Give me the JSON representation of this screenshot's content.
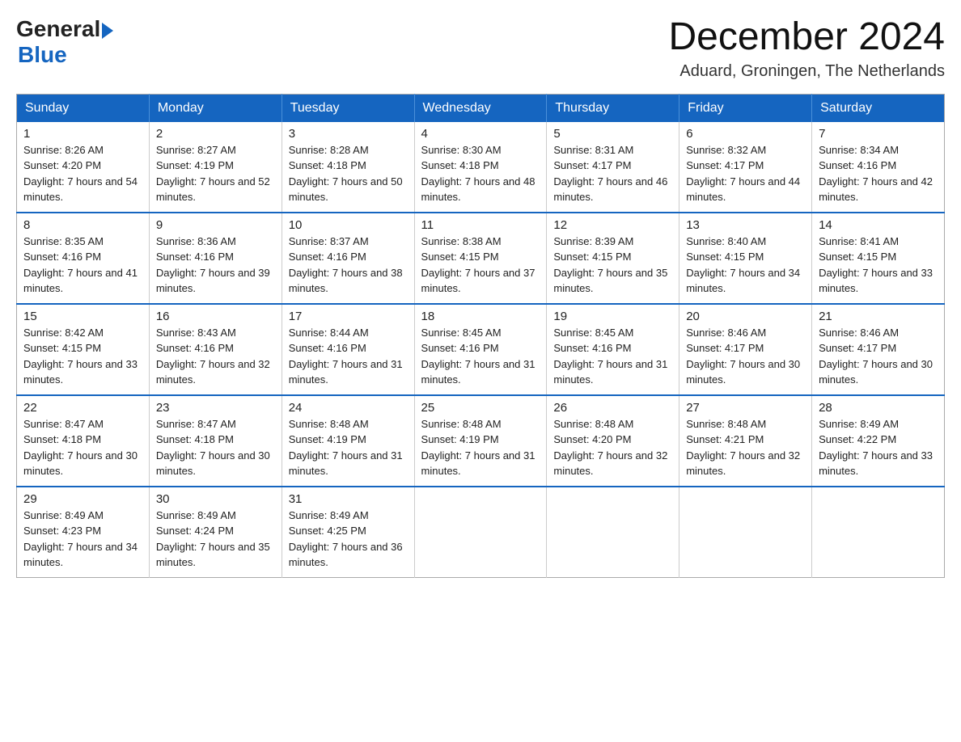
{
  "logo": {
    "general": "General",
    "arrow": "▶",
    "blue": "Blue"
  },
  "header": {
    "month_year": "December 2024",
    "location": "Aduard, Groningen, The Netherlands"
  },
  "weekdays": [
    "Sunday",
    "Monday",
    "Tuesday",
    "Wednesday",
    "Thursday",
    "Friday",
    "Saturday"
  ],
  "weeks": [
    [
      {
        "day": "1",
        "sunrise": "8:26 AM",
        "sunset": "4:20 PM",
        "daylight": "7 hours and 54 minutes."
      },
      {
        "day": "2",
        "sunrise": "8:27 AM",
        "sunset": "4:19 PM",
        "daylight": "7 hours and 52 minutes."
      },
      {
        "day": "3",
        "sunrise": "8:28 AM",
        "sunset": "4:18 PM",
        "daylight": "7 hours and 50 minutes."
      },
      {
        "day": "4",
        "sunrise": "8:30 AM",
        "sunset": "4:18 PM",
        "daylight": "7 hours and 48 minutes."
      },
      {
        "day": "5",
        "sunrise": "8:31 AM",
        "sunset": "4:17 PM",
        "daylight": "7 hours and 46 minutes."
      },
      {
        "day": "6",
        "sunrise": "8:32 AM",
        "sunset": "4:17 PM",
        "daylight": "7 hours and 44 minutes."
      },
      {
        "day": "7",
        "sunrise": "8:34 AM",
        "sunset": "4:16 PM",
        "daylight": "7 hours and 42 minutes."
      }
    ],
    [
      {
        "day": "8",
        "sunrise": "8:35 AM",
        "sunset": "4:16 PM",
        "daylight": "7 hours and 41 minutes."
      },
      {
        "day": "9",
        "sunrise": "8:36 AM",
        "sunset": "4:16 PM",
        "daylight": "7 hours and 39 minutes."
      },
      {
        "day": "10",
        "sunrise": "8:37 AM",
        "sunset": "4:16 PM",
        "daylight": "7 hours and 38 minutes."
      },
      {
        "day": "11",
        "sunrise": "8:38 AM",
        "sunset": "4:15 PM",
        "daylight": "7 hours and 37 minutes."
      },
      {
        "day": "12",
        "sunrise": "8:39 AM",
        "sunset": "4:15 PM",
        "daylight": "7 hours and 35 minutes."
      },
      {
        "day": "13",
        "sunrise": "8:40 AM",
        "sunset": "4:15 PM",
        "daylight": "7 hours and 34 minutes."
      },
      {
        "day": "14",
        "sunrise": "8:41 AM",
        "sunset": "4:15 PM",
        "daylight": "7 hours and 33 minutes."
      }
    ],
    [
      {
        "day": "15",
        "sunrise": "8:42 AM",
        "sunset": "4:15 PM",
        "daylight": "7 hours and 33 minutes."
      },
      {
        "day": "16",
        "sunrise": "8:43 AM",
        "sunset": "4:16 PM",
        "daylight": "7 hours and 32 minutes."
      },
      {
        "day": "17",
        "sunrise": "8:44 AM",
        "sunset": "4:16 PM",
        "daylight": "7 hours and 31 minutes."
      },
      {
        "day": "18",
        "sunrise": "8:45 AM",
        "sunset": "4:16 PM",
        "daylight": "7 hours and 31 minutes."
      },
      {
        "day": "19",
        "sunrise": "8:45 AM",
        "sunset": "4:16 PM",
        "daylight": "7 hours and 31 minutes."
      },
      {
        "day": "20",
        "sunrise": "8:46 AM",
        "sunset": "4:17 PM",
        "daylight": "7 hours and 30 minutes."
      },
      {
        "day": "21",
        "sunrise": "8:46 AM",
        "sunset": "4:17 PM",
        "daylight": "7 hours and 30 minutes."
      }
    ],
    [
      {
        "day": "22",
        "sunrise": "8:47 AM",
        "sunset": "4:18 PM",
        "daylight": "7 hours and 30 minutes."
      },
      {
        "day": "23",
        "sunrise": "8:47 AM",
        "sunset": "4:18 PM",
        "daylight": "7 hours and 30 minutes."
      },
      {
        "day": "24",
        "sunrise": "8:48 AM",
        "sunset": "4:19 PM",
        "daylight": "7 hours and 31 minutes."
      },
      {
        "day": "25",
        "sunrise": "8:48 AM",
        "sunset": "4:19 PM",
        "daylight": "7 hours and 31 minutes."
      },
      {
        "day": "26",
        "sunrise": "8:48 AM",
        "sunset": "4:20 PM",
        "daylight": "7 hours and 32 minutes."
      },
      {
        "day": "27",
        "sunrise": "8:48 AM",
        "sunset": "4:21 PM",
        "daylight": "7 hours and 32 minutes."
      },
      {
        "day": "28",
        "sunrise": "8:49 AM",
        "sunset": "4:22 PM",
        "daylight": "7 hours and 33 minutes."
      }
    ],
    [
      {
        "day": "29",
        "sunrise": "8:49 AM",
        "sunset": "4:23 PM",
        "daylight": "7 hours and 34 minutes."
      },
      {
        "day": "30",
        "sunrise": "8:49 AM",
        "sunset": "4:24 PM",
        "daylight": "7 hours and 35 minutes."
      },
      {
        "day": "31",
        "sunrise": "8:49 AM",
        "sunset": "4:25 PM",
        "daylight": "7 hours and 36 minutes."
      },
      null,
      null,
      null,
      null
    ]
  ]
}
